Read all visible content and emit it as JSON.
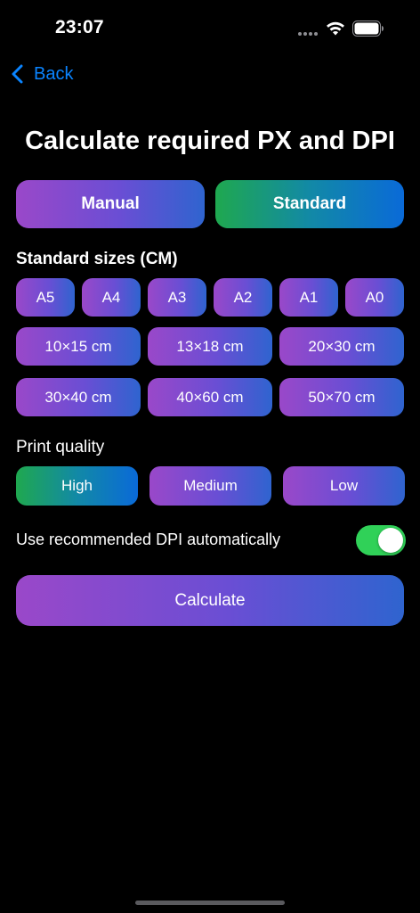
{
  "status_bar": {
    "time": "23:07",
    "wifi_icon": "wifi-icon",
    "battery_icon": "battery-icon"
  },
  "nav": {
    "back_label": "Back",
    "back_icon": "chevron-left-icon"
  },
  "title": "Calculate required PX and DPI",
  "mode": {
    "options": [
      "Manual",
      "Standard"
    ],
    "selected": "Standard"
  },
  "standard_sizes": {
    "label": "Standard sizes (CM)",
    "paper": [
      "A5",
      "A4",
      "A3",
      "A2",
      "A1",
      "A0"
    ],
    "photo": [
      "10×15 cm",
      "13×18 cm",
      "20×30 cm",
      "30×40 cm",
      "40×60 cm",
      "50×70 cm"
    ]
  },
  "print_quality": {
    "label": "Print quality",
    "options": [
      "High",
      "Medium",
      "Low"
    ],
    "selected": "High"
  },
  "auto_dpi": {
    "label": "Use recommended DPI automatically",
    "enabled": true
  },
  "calculate_label": "Calculate",
  "colors": {
    "accent": "#0a84ff",
    "toggle_on": "#30d158",
    "button_gradient": [
      "#9a48c9",
      "#2f64cf"
    ],
    "selected_gradient": [
      "#1fa84f",
      "#0a6ad8"
    ]
  }
}
